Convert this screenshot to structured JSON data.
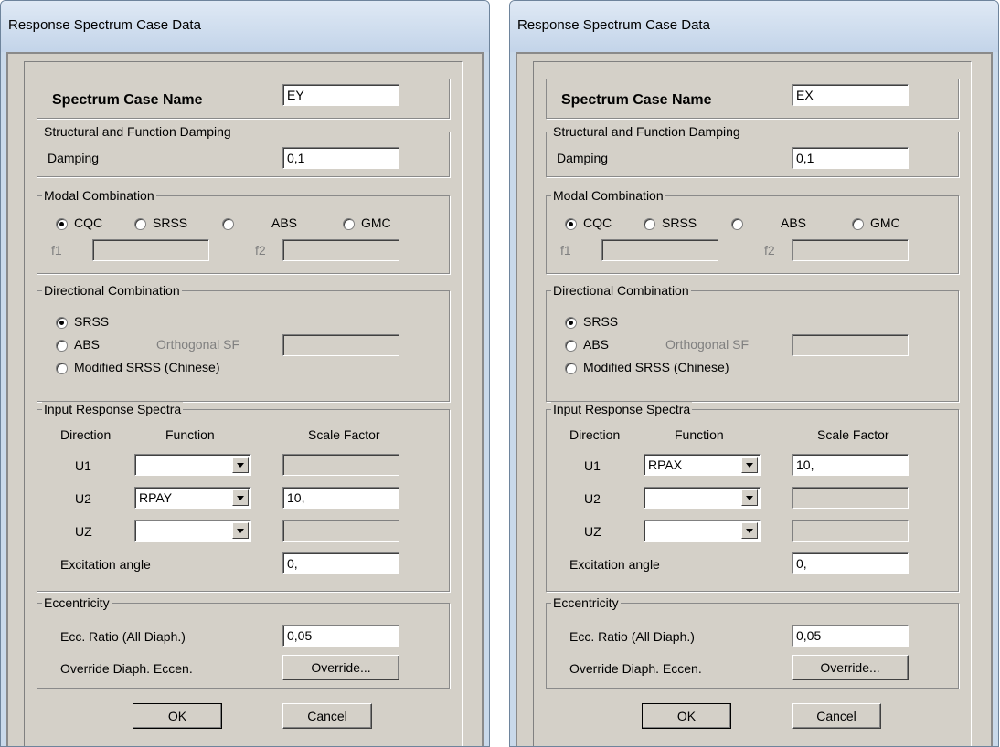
{
  "dialogs": [
    {
      "title": "Response Spectrum Case Data",
      "spectrum_case_name_label": "Spectrum Case Name",
      "spectrum_case_name": "EY",
      "damping_group": "Structural and Function Damping",
      "damping_label": "Damping",
      "damping_value": "0,1",
      "modal_group": "Modal Combination",
      "modal_options": [
        "CQC",
        "SRSS",
        "ABS",
        "GMC"
      ],
      "modal_selected": "CQC",
      "f1_label": "f1",
      "f2_label": "f2",
      "f1_value": "",
      "f2_value": "",
      "directional_group": "Directional Combination",
      "directional_options": [
        "SRSS",
        "ABS",
        "Modified SRSS (Chinese)"
      ],
      "directional_selected": "SRSS",
      "orthogonal_sf_label": "Orthogonal SF",
      "orthogonal_sf_value": "",
      "input_group": "Input Response Spectra",
      "direction_header": "Direction",
      "function_header": "Function",
      "scale_header": "Scale Factor",
      "rows": [
        {
          "direction": "U1",
          "function": "",
          "scale": ""
        },
        {
          "direction": "U2",
          "function": "RPAY",
          "scale": "10,"
        },
        {
          "direction": "UZ",
          "function": "",
          "scale": ""
        }
      ],
      "excitation_label": "Excitation  angle",
      "excitation_value": "0,",
      "ecc_group": "Eccentricity",
      "ecc_ratio_label": "Ecc. Ratio (All Diaph.)",
      "ecc_ratio_value": "0,05",
      "override_label": "Override Diaph. Eccen.",
      "override_button": "Override...",
      "ok_button": "OK",
      "cancel_button": "Cancel"
    },
    {
      "title": "Response Spectrum Case Data",
      "spectrum_case_name_label": "Spectrum Case Name",
      "spectrum_case_name": "EX",
      "damping_group": "Structural and Function Damping",
      "damping_label": "Damping",
      "damping_value": "0,1",
      "modal_group": "Modal Combination",
      "modal_options": [
        "CQC",
        "SRSS",
        "ABS",
        "GMC"
      ],
      "modal_selected": "CQC",
      "f1_label": "f1",
      "f2_label": "f2",
      "f1_value": "",
      "f2_value": "",
      "directional_group": "Directional Combination",
      "directional_options": [
        "SRSS",
        "ABS",
        "Modified SRSS (Chinese)"
      ],
      "directional_selected": "SRSS",
      "orthogonal_sf_label": "Orthogonal SF",
      "orthogonal_sf_value": "",
      "input_group": "Input Response Spectra",
      "direction_header": "Direction",
      "function_header": "Function",
      "scale_header": "Scale Factor",
      "rows": [
        {
          "direction": "U1",
          "function": "RPAX",
          "scale": "10,"
        },
        {
          "direction": "U2",
          "function": "",
          "scale": ""
        },
        {
          "direction": "UZ",
          "function": "",
          "scale": ""
        }
      ],
      "excitation_label": "Excitation  angle",
      "excitation_value": "0,",
      "ecc_group": "Eccentricity",
      "ecc_ratio_label": "Ecc. Ratio (All Diaph.)",
      "ecc_ratio_value": "0,05",
      "override_label": "Override Diaph. Eccen.",
      "override_button": "Override...",
      "ok_button": "OK",
      "cancel_button": "Cancel"
    }
  ]
}
